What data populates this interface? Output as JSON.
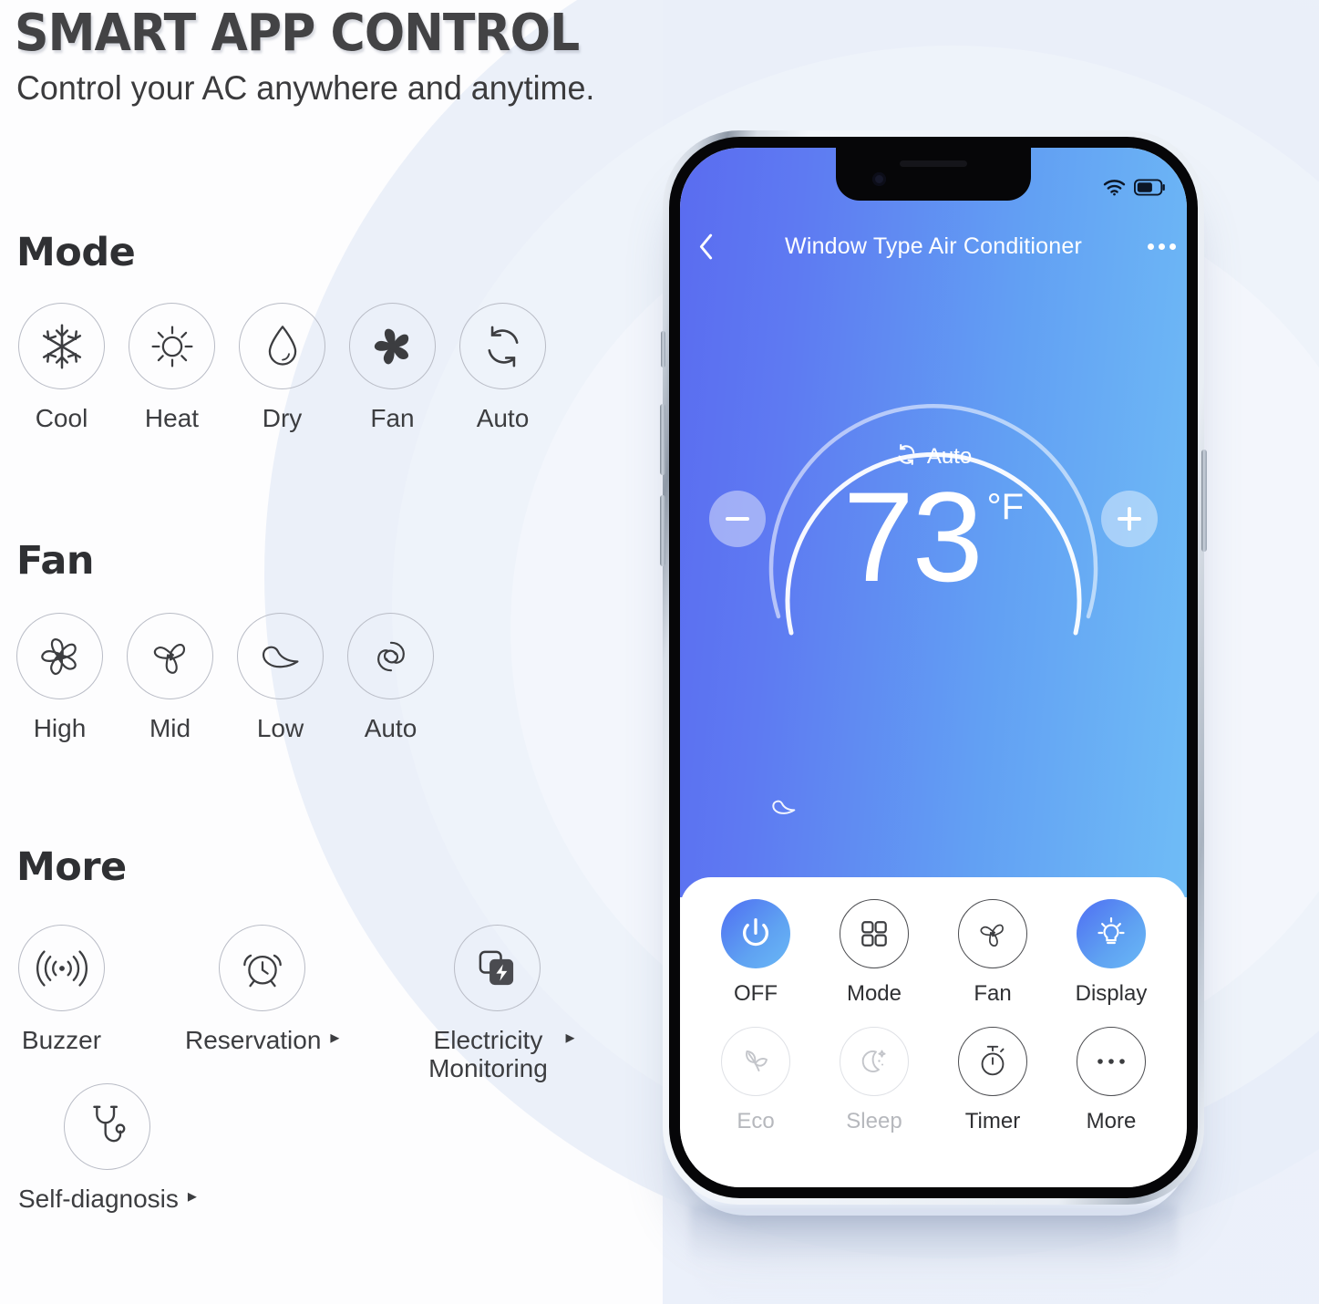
{
  "header": {
    "title": "SMART APP CONTROL",
    "subtitle": "Control your AC anywhere and anytime."
  },
  "sections": {
    "mode": {
      "heading": "Mode",
      "items": [
        {
          "label": "Cool",
          "icon": "snowflake-icon"
        },
        {
          "label": "Heat",
          "icon": "sun-icon"
        },
        {
          "label": "Dry",
          "icon": "droplet-icon"
        },
        {
          "label": "Fan",
          "icon": "fan-blades-icon"
        },
        {
          "label": "Auto",
          "icon": "auto-cycle-icon"
        }
      ]
    },
    "fan": {
      "heading": "Fan",
      "items": [
        {
          "label": "High",
          "icon": "fan-five-blade-icon"
        },
        {
          "label": "Mid",
          "icon": "fan-three-blade-icon"
        },
        {
          "label": "Low",
          "icon": "fan-single-leaf-icon"
        },
        {
          "label": "Auto",
          "icon": "fan-swirl-icon"
        }
      ]
    },
    "more": {
      "heading": "More",
      "items": [
        {
          "label": "Buzzer",
          "icon": "sound-waves-icon",
          "arrow": ""
        },
        {
          "label": "Reservation",
          "icon": "alarm-clock-icon",
          "arrow": "▸"
        },
        {
          "label": "Electricity Monitoring",
          "icon": "power-monitor-icon",
          "arrow": "▸"
        },
        {
          "label": "Self-diagnosis",
          "icon": "stethoscope-icon",
          "arrow": "▸"
        }
      ]
    }
  },
  "phone": {
    "status": {
      "wifi": "wifi-icon",
      "battery": "battery-icon",
      "battery_level": 60
    },
    "appbar": {
      "back": "back-chevron-icon",
      "title": "Window Type Air Conditioner",
      "menu": "overflow-menu-icon"
    },
    "dial": {
      "mode_icon": "auto-cycle-icon",
      "mode_label": "Auto",
      "temperature": "73",
      "unit": "°F",
      "minus": "minus-icon",
      "plus": "plus-icon",
      "swing_icon": "fan-single-leaf-icon"
    },
    "controls": [
      {
        "label": "OFF",
        "icon": "power-icon",
        "style": "fill",
        "state": "active"
      },
      {
        "label": "Mode",
        "icon": "grid-squares-icon",
        "style": "outline",
        "state": "active"
      },
      {
        "label": "Fan",
        "icon": "fan-three-blade-icon",
        "style": "outline",
        "state": "active"
      },
      {
        "label": "Display",
        "icon": "lightbulb-icon",
        "style": "fill",
        "state": "active"
      },
      {
        "label": "Eco",
        "icon": "leaves-icon",
        "style": "outline",
        "state": "disabled"
      },
      {
        "label": "Sleep",
        "icon": "moon-stars-icon",
        "style": "outline",
        "state": "disabled"
      },
      {
        "label": "Timer",
        "icon": "stopwatch-icon",
        "style": "outline",
        "state": "active"
      },
      {
        "label": "More",
        "icon": "ellipsis-icon",
        "style": "outline",
        "state": "active"
      }
    ]
  },
  "colors": {
    "accent_start": "#4f6ef3",
    "accent_end": "#6ab8f6",
    "screen_blue_left": "#5a6cf0",
    "screen_blue_right": "#6fbcf6",
    "text_dark": "#2f3033",
    "outline_gray": "#b9bcc6",
    "disabled_gray": "#b6b8bd",
    "bg_tint": "#eef2fa"
  }
}
